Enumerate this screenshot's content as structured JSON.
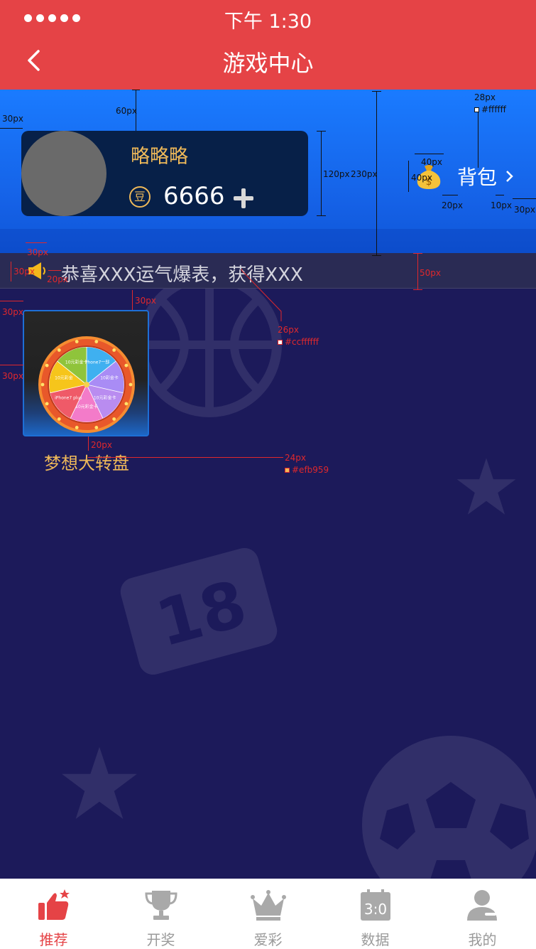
{
  "status_bar": {
    "time": "下午 1:30"
  },
  "nav": {
    "title": "游戏中心",
    "back_icon": "chevron-left-icon"
  },
  "user": {
    "name": "略略略",
    "coin_label": "豆",
    "balance": "6666"
  },
  "bag": {
    "label": "背包",
    "icon": "money-bag-icon"
  },
  "notice": {
    "text": "恭喜XXX运气爆表，获得XXX"
  },
  "games": [
    {
      "name": "梦想大转盘",
      "icon": "prize-wheel-icon"
    }
  ],
  "wheel_slices": [
    "iPhone7一部",
    "10彩金卡",
    "10元彩金卡",
    "10元彩金卡",
    "iPhone7 plus",
    "10元彩金",
    "10元彩金卡"
  ],
  "annotations": {
    "a1": "30px",
    "a2": "60px",
    "a3": "120px",
    "a4": "230px",
    "a5": "28px",
    "a6": "#ffffff",
    "a7": "40px",
    "a8": "40px",
    "a9": "20px",
    "a10": "10px",
    "a11": "30px",
    "a12": "30px",
    "a13": "30px",
    "a14": "20px",
    "a15": "50px",
    "a16": "30px",
    "a17": "30px",
    "a18": "26px",
    "a19": "#ccffffff",
    "a20": "30px",
    "a21": "20px",
    "a22": "24px",
    "a23": "#efb959"
  },
  "tabs": [
    {
      "label": "推荐",
      "icon": "thumbs-up-icon",
      "active": true
    },
    {
      "label": "开奖",
      "icon": "trophy-icon"
    },
    {
      "label": "爱彩",
      "icon": "crown-icon"
    },
    {
      "label": "数据",
      "icon": "scoreboard-icon",
      "score": "3:0"
    },
    {
      "label": "我的",
      "icon": "user-icon"
    }
  ],
  "colors": {
    "primary_red": "#e54346",
    "band_blue": "#1561e6",
    "gold": "#efb959",
    "page_bg": "#1c1a5a",
    "annotation": "#e0282c"
  }
}
